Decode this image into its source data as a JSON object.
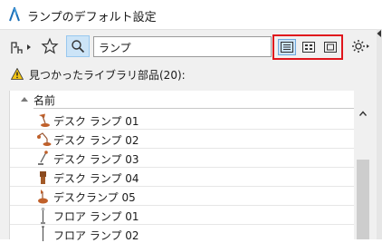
{
  "window": {
    "title": "ランプのデフォルト設定"
  },
  "toolbar": {
    "search_value": "ランプ",
    "view_buttons": [
      {
        "icon": "list-view-icon",
        "active": true
      },
      {
        "icon": "grid-view-icon",
        "active": false
      },
      {
        "icon": "large-preview-icon",
        "active": false
      }
    ],
    "icons": {
      "filter": "object-filter-icon",
      "favorites": "star-icon",
      "search": "search-icon",
      "settings": "gear-icon"
    }
  },
  "results": {
    "text": "見つかったライブラリ部品(20):"
  },
  "tree": {
    "header": "名前",
    "items": [
      {
        "label": "デスク ランプ 01",
        "icon": "desk-lamp-icon"
      },
      {
        "label": "デスク ランプ 02",
        "icon": "desk-lamp-icon"
      },
      {
        "label": "デスク ランプ 03",
        "icon": "desk-lamp-icon"
      },
      {
        "label": "デスク ランプ 04",
        "icon": "desk-lamp-icon"
      },
      {
        "label": "デスクランプ 05",
        "icon": "desk-lamp-icon"
      },
      {
        "label": "フロア ランプ 01",
        "icon": "floor-lamp-icon"
      },
      {
        "label": "フロア ランプ 02",
        "icon": "floor-lamp-icon"
      }
    ]
  },
  "colors": {
    "highlight_box": "#e0161c",
    "active_button": "#cce4f7",
    "lamp_icon": "#c0602a"
  }
}
